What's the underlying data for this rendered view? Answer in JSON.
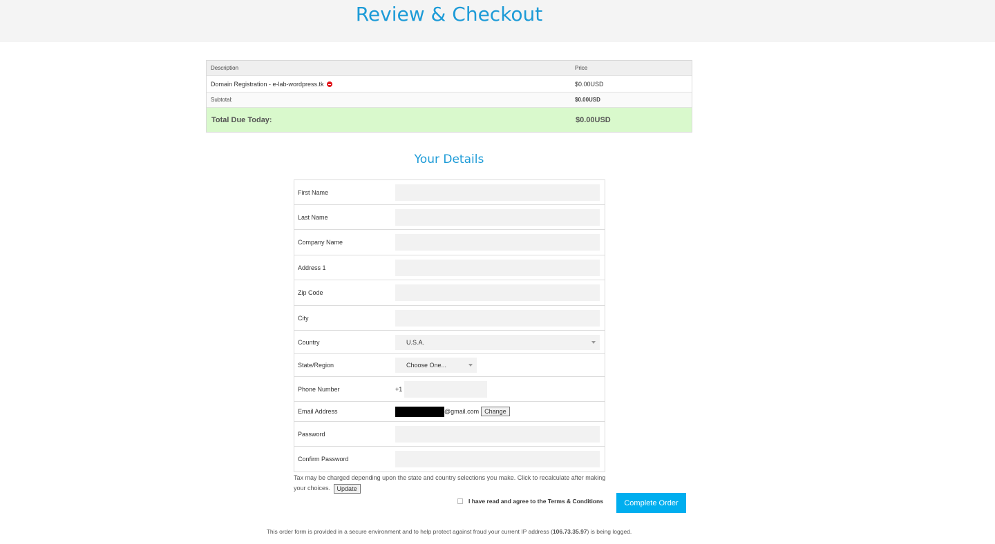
{
  "header": {
    "title": "Review & Checkout"
  },
  "summary": {
    "headers": {
      "description": "Description",
      "price": "Price"
    },
    "items": [
      {
        "description": "Domain Registration - e-lab-wordpress.tk",
        "price": "$0.00USD"
      }
    ],
    "subtotal": {
      "label": "Subtotal:",
      "value": "$0.00USD"
    },
    "total": {
      "label": "Total Due Today:",
      "value": "$0.00USD"
    }
  },
  "details": {
    "title": "Your Details",
    "fields": {
      "first_name": {
        "label": "First Name",
        "value": ""
      },
      "last_name": {
        "label": "Last Name",
        "value": ""
      },
      "company_name": {
        "label": "Company Name",
        "value": ""
      },
      "address1": {
        "label": "Address 1",
        "value": ""
      },
      "zip": {
        "label": "Zip Code",
        "value": ""
      },
      "city": {
        "label": "City",
        "value": ""
      },
      "country": {
        "label": "Country",
        "value": "U.S.A."
      },
      "state": {
        "label": "State/Region",
        "value": "Choose One..."
      },
      "phone": {
        "label": "Phone Number",
        "prefix": "+1",
        "value": ""
      },
      "email": {
        "label": "Email Address",
        "domain": "@gmail.com",
        "change_label": "Change"
      },
      "password": {
        "label": "Password",
        "value": ""
      },
      "confirm_password": {
        "label": "Confirm Password",
        "value": ""
      }
    }
  },
  "tax_note": {
    "text": "Tax may be charged depending upon the state and country selections you make. Click to recalculate after making your choices.",
    "update_label": "Update"
  },
  "terms": {
    "prefix": "I have read and agree to the ",
    "link": "Terms & Conditions"
  },
  "complete_button": "Complete Order",
  "footer": {
    "before": "This order form is provided in a secure environment and to help protect against fraud your current IP address (",
    "ip": "106.73.35.97",
    "after": ") is being logged."
  },
  "colors": {
    "accent": "#1d9bd7",
    "button": "#00aeef",
    "total_bg": "#d9f9cc",
    "remove": "#e0161d"
  }
}
